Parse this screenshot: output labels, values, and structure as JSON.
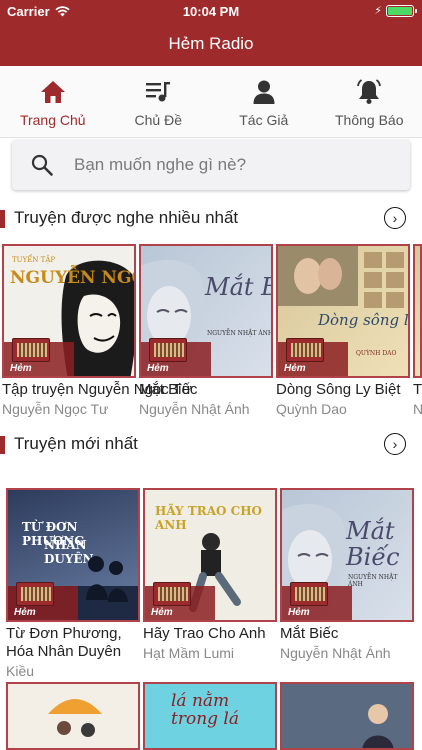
{
  "status_bar": {
    "carrier": "Carrier",
    "time": "10:04 PM"
  },
  "header": {
    "title": "Hẻm Radio"
  },
  "tabs": [
    {
      "label": "Trang Chủ",
      "icon": "home-icon",
      "active": true
    },
    {
      "label": "Chủ Đề",
      "icon": "playlist-icon",
      "active": false
    },
    {
      "label": "Tác Giả",
      "icon": "person-icon",
      "active": false
    },
    {
      "label": "Thông Báo",
      "icon": "bell-icon",
      "active": false
    }
  ],
  "search": {
    "placeholder": "Bạn muốn nghe gì nè?"
  },
  "sections": [
    {
      "title": "Truyện được nghe nhiều nhất",
      "items": [
        {
          "name": "Tập truyện Nguyễn Ngọc Tư",
          "author": "Nguyễn Ngọc Tư",
          "cover_text": "NGUYỄN NGỌC TƯ",
          "cover_small": "TUYỂN TẬP"
        },
        {
          "name": "Mắt Biếc",
          "author": "Nguyễn Nhật Ánh",
          "cover_text": "Mắt Biếc",
          "cover_small": "NGUYỄN NHẬT ÁNH"
        },
        {
          "name": "Dòng Sông Ly Biệt",
          "author": "Quỳnh Dao",
          "cover_text": "Dòng sông ly biệt",
          "cover_small": "QUỲNH DAO"
        },
        {
          "name": "T",
          "author": "N"
        }
      ]
    },
    {
      "title": "Truyện mới nhất",
      "items": [
        {
          "name": "Từ Đơn Phương, Hóa Nhân Duyên",
          "author": "Kiều",
          "cover_text": "TỪ ĐƠN PHƯƠNG",
          "cover_small": "NHÂN DUYÊN"
        },
        {
          "name": "Hãy Trao Cho Anh",
          "author": "Hạt Mầm Lumi",
          "cover_text": "HÃY TRAO CHO ANH"
        },
        {
          "name": "Mắt Biếc",
          "author": "Nguyễn Nhật Ánh",
          "cover_text": "Mắt Biếc",
          "cover_small": "NGUYỄN NHẬT ÁNH"
        }
      ]
    }
  ],
  "row3": {
    "cover2_text": "lá nằm trong lá"
  },
  "logo_text": "Hẻm",
  "colors": {
    "brand": "#9e2a2b",
    "active_tab": "#9e2a2b",
    "battery": "#4cd964"
  }
}
